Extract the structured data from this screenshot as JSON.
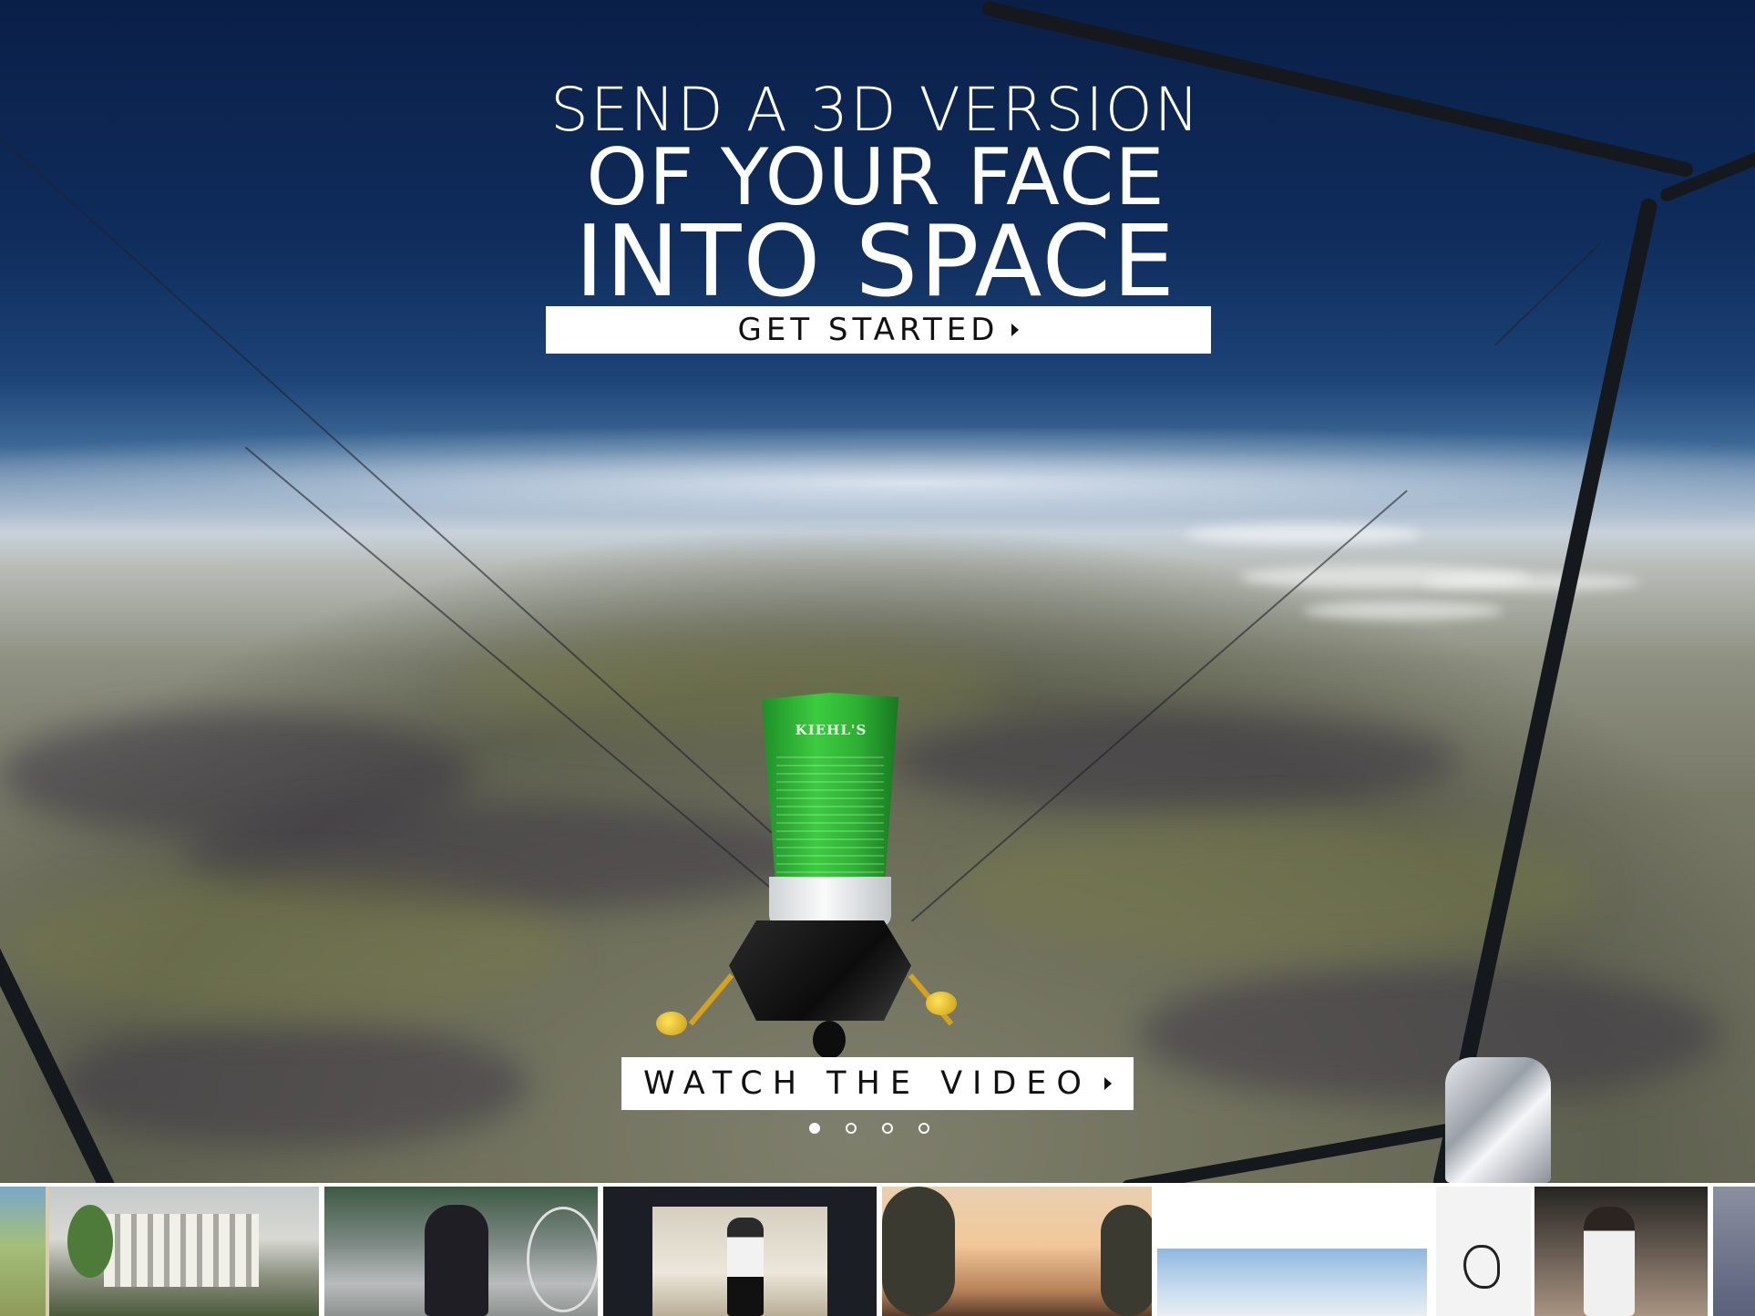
{
  "hero": {
    "headline_line1": "SEND A 3D VERSION",
    "headline_line2": "OF YOUR FACE",
    "headline_line3": "INTO SPACE",
    "get_started_label": "GET STARTED",
    "watch_video_label": "WATCH THE VIDEO",
    "product_brand": "KIEHL'S"
  },
  "carousel": {
    "slide_count": 4,
    "active_slide": 1
  },
  "thumbnails": [
    {
      "name": "photo-park"
    },
    {
      "name": "photo-building-plaza"
    },
    {
      "name": "photo-parking-lot"
    },
    {
      "name": "photo-hallway"
    },
    {
      "name": "photo-sunset-trees"
    },
    {
      "name": "photo-sky"
    },
    {
      "name": "photo-bird-sketch"
    },
    {
      "name": "photo-man-room"
    },
    {
      "name": "photo-partial"
    }
  ]
}
